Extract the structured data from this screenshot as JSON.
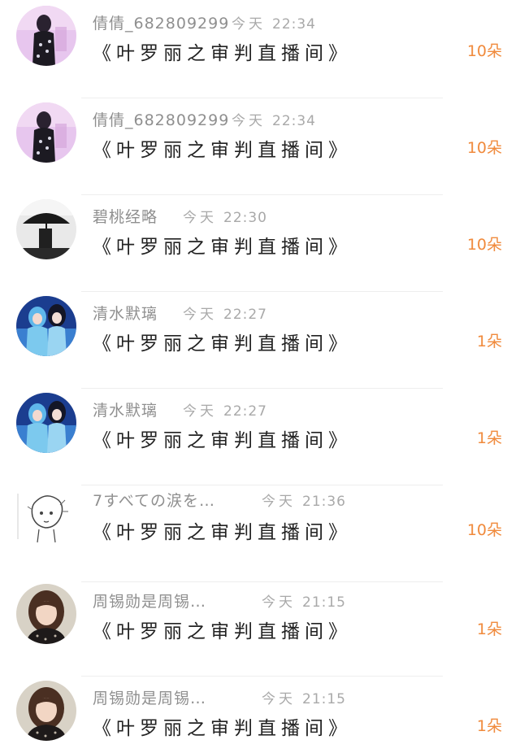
{
  "gift_list": {
    "items": [
      {
        "user": "倩倩_682809299",
        "day": "今天",
        "time": "22:34",
        "room": "《叶罗丽之审判直播间》",
        "gift": "10朵",
        "avatar_icon": "avatar-girl-pink-icon"
      },
      {
        "user": "倩倩_682809299",
        "day": "今天",
        "time": "22:34",
        "room": "《叶罗丽之审判直播间》",
        "gift": "10朵",
        "avatar_icon": "avatar-girl-pink-icon"
      },
      {
        "user": "碧桃经略",
        "day": "今天",
        "time": "22:30",
        "room": "《叶罗丽之审判直播间》",
        "gift": "10朵",
        "avatar_icon": "avatar-umbrella-silhouette-icon"
      },
      {
        "user": "清水默璃",
        "day": "今天",
        "time": "22:27",
        "room": "《叶罗丽之审判直播间》",
        "gift": "1朵",
        "avatar_icon": "avatar-anime-blue-icon"
      },
      {
        "user": "清水默璃",
        "day": "今天",
        "time": "22:27",
        "room": "《叶罗丽之审判直播间》",
        "gift": "1朵",
        "avatar_icon": "avatar-anime-blue-icon"
      },
      {
        "user": "7すべての涙を…",
        "day": "今天",
        "time": "21:36",
        "room": "《叶罗丽之审判直播间》",
        "gift": "10朵",
        "avatar_icon": "avatar-sketch-boy-icon"
      },
      {
        "user": "周锡勋是周锡…",
        "day": "今天",
        "time": "21:15",
        "room": "《叶罗丽之审判直播间》",
        "gift": "1朵",
        "avatar_icon": "avatar-photo-girl-icon"
      },
      {
        "user": "周锡勋是周锡…",
        "day": "今天",
        "time": "21:15",
        "room": "《叶罗丽之审判直播间》",
        "gift": "1朵",
        "avatar_icon": "avatar-photo-girl-icon"
      }
    ]
  },
  "colors": {
    "gift_accent": "#f08a3c",
    "name_gray": "#8f8f8f",
    "time_gray": "#a9a9a9"
  }
}
